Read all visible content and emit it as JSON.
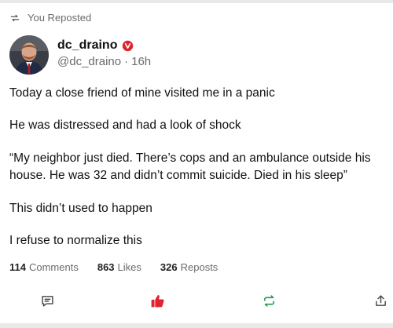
{
  "repost_label": "You Reposted",
  "author": {
    "name": "dc_draino",
    "handle": "@dc_draino",
    "separator": "·",
    "time": "16h"
  },
  "post": {
    "paragraphs": [
      "Today a close friend of mine visited me in a panic",
      "He was distressed and had a look of shock",
      "“My neighbor just died. There’s cops and an ambulance outside his house. He was 32 and didn’t commit suicide. Died in his sleep”",
      "This didn’t used to happen",
      "I refuse to normalize this"
    ]
  },
  "stats": {
    "comments_count": "114",
    "comments_label": "Comments",
    "likes_count": "863",
    "likes_label": "Likes",
    "reposts_count": "326",
    "reposts_label": "Reposts"
  },
  "icons": {
    "repost_header": "repost-icon",
    "verified": "verified-badge-icon",
    "comment": "comment-icon",
    "like": "thumbs-up-icon",
    "repost": "repost-icon",
    "share": "share-icon"
  },
  "colors": {
    "verified": "#e0242f",
    "like_active": "#e0242f",
    "repost_active": "#2e9e5b",
    "muted_text": "#6b6b6b"
  }
}
